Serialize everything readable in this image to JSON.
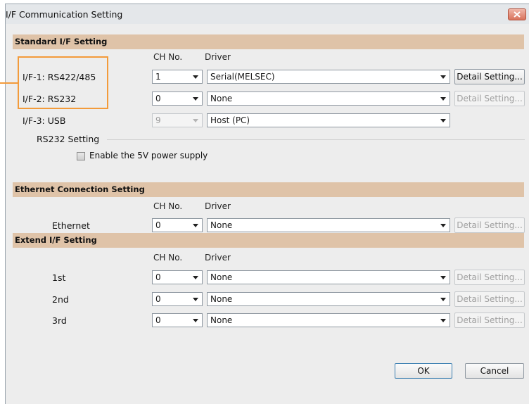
{
  "window": {
    "title": "I/F Communication Setting",
    "close_icon": "close-icon"
  },
  "standard": {
    "header": "Standard I/F Setting",
    "ch_no_label": "CH No.",
    "driver_label": "Driver",
    "rows": [
      {
        "label": "I/F-1:  RS422/485",
        "ch": "1",
        "driver": "Serial(MELSEC)",
        "detail": "Detail Setting...",
        "detail_enabled": true,
        "ch_enabled": true
      },
      {
        "label": "I/F-2:  RS232",
        "ch": "0",
        "driver": "None",
        "detail": "Detail Setting...",
        "detail_enabled": false,
        "ch_enabled": true
      },
      {
        "label": "I/F-3:  USB",
        "ch": "9",
        "driver": "Host (PC)",
        "ch_enabled": false
      }
    ],
    "rs232_group_label": "RS232 Setting",
    "enable_5v_label": "Enable the 5V power supply",
    "enable_5v_checked": false
  },
  "ethernet": {
    "header": "Ethernet Connection Setting",
    "ch_no_label": "CH No.",
    "driver_label": "Driver",
    "row": {
      "label": "Ethernet",
      "ch": "0",
      "driver": "None",
      "detail": "Detail Setting..."
    }
  },
  "extend": {
    "header": "Extend I/F Setting",
    "ch_no_label": "CH No.",
    "driver_label": "Driver",
    "rows": [
      {
        "label": "1st",
        "ch": "0",
        "driver": "None",
        "detail": "Detail Setting..."
      },
      {
        "label": "2nd",
        "ch": "0",
        "driver": "None",
        "detail": "Detail Setting..."
      },
      {
        "label": "3rd",
        "ch": "0",
        "driver": "None",
        "detail": "Detail Setting..."
      }
    ]
  },
  "footer": {
    "ok_label": "OK",
    "cancel_label": "Cancel"
  },
  "colors": {
    "section_header": "#dfc3a8",
    "highlight": "#f39b3b"
  }
}
